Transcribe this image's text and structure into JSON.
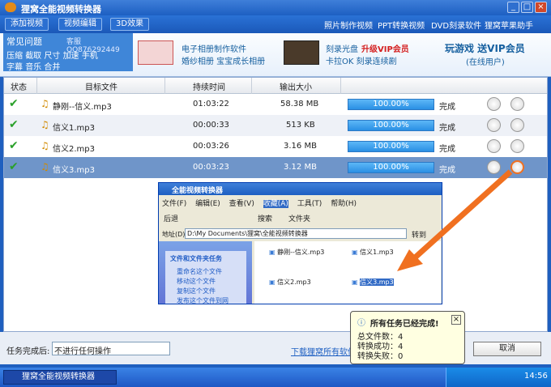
{
  "app": {
    "title": "狸窝全能视频转换器"
  },
  "toolbar": {
    "buttons": [
      "添加视频",
      "视频编辑",
      "3D效果"
    ],
    "links": [
      "照片制作视频",
      "PPT转换视频",
      "DVD刻录软件",
      "狸窝苹果助手"
    ]
  },
  "banner": {
    "faq_title": "常见问题",
    "faq_support": "客服QQ876292449",
    "faq_links_row1": [
      "压缩",
      "截取",
      "尺寸",
      "加速",
      "手机"
    ],
    "faq_links_row2": [
      "字幕",
      "音乐",
      "合并"
    ],
    "ad1_line1": "电子相册制作软件",
    "ad1_line2": "婚纱相册  宝宝成长相册",
    "ad2_line1a": "刻录光盘",
    "ad2_line1b": "升级VIP会员",
    "ad2_line2": "卡拉OK 刻录连续剧",
    "ad3_line1": "玩游戏 送VIP会员",
    "ad3_line2": "(在线用户)"
  },
  "table": {
    "headers": [
      "状态",
      "目标文件",
      "持续时间",
      "输出大小"
    ],
    "rows": [
      {
        "file": "静刚--信义.mp3",
        "duration": "01:03:22",
        "size": "58.38 MB",
        "progress": "100.00%",
        "status": "完成"
      },
      {
        "file": "信义1.mp3",
        "duration": "00:00:33",
        "size": "513 KB",
        "progress": "100.00%",
        "status": "完成"
      },
      {
        "file": "信义2.mp3",
        "duration": "00:03:26",
        "size": "3.16 MB",
        "progress": "100.00%",
        "status": "完成"
      },
      {
        "file": "信义3.mp3",
        "duration": "00:03:23",
        "size": "3.12 MB",
        "progress": "100.00%",
        "status": "完成"
      }
    ]
  },
  "bottom": {
    "after_label": "任务完成后:",
    "after_value": "不进行任何操作",
    "download_link": "下载狸窝所有软件",
    "cancel": "取消"
  },
  "explorer": {
    "title": "全能视频转换器",
    "menu": [
      "文件(F)",
      "编辑(E)",
      "查看(V)",
      "收藏(A)",
      "工具(T)",
      "帮助(H)"
    ],
    "back": "后退",
    "search": "搜索",
    "folders": "文件夹",
    "address_label": "地址(D)",
    "address_value": "D:\\My Documents\\狸窝\\全能视频转换器",
    "go": "转到",
    "tasks_title": "文件和文件夹任务",
    "tasks": [
      "重命名这个文件",
      "移动这个文件",
      "复制这个文件",
      "发布这个文件到网"
    ],
    "files": [
      "静刚--信义.mp3",
      "信义1.mp3",
      "信义2.mp3",
      "信义3.mp3"
    ]
  },
  "balloon": {
    "title": "所有任务已经完成!",
    "lines": [
      "总文件数：4",
      "转换成功：4",
      "转换失败：0"
    ]
  },
  "taskbar": {
    "app": "狸窝全能视频转换器",
    "time": "14:56"
  },
  "colors": {
    "accent": "#1d5fc2",
    "progress": "#2a8fe4",
    "highlight": "#f07020"
  }
}
